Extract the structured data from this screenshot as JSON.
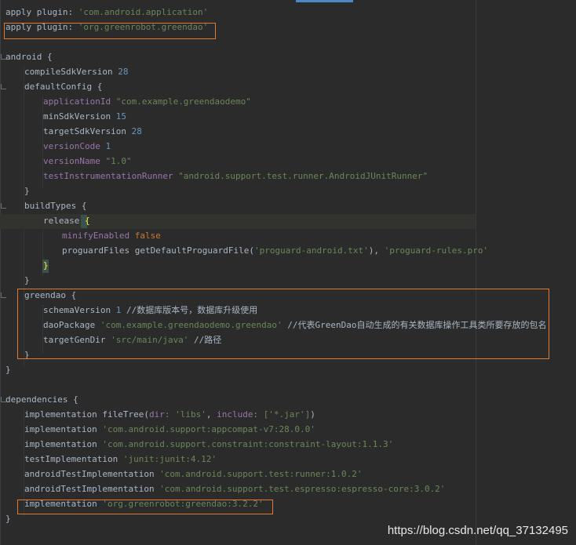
{
  "lines": [
    [
      "apply plugin: ",
      "'com.android.application'"
    ],
    [
      "apply plugin: ",
      "'org.greenrobot.greendao'"
    ],
    [
      "android {"
    ],
    [
      "compileSdkVersion ",
      "28"
    ],
    [
      "defaultConfig {"
    ],
    [
      "applicationId ",
      "\"com.example.greendaodemo\""
    ],
    [
      "minSdkVersion ",
      "15"
    ],
    [
      "targetSdkVersion ",
      "28"
    ],
    [
      "versionCode ",
      "1"
    ],
    [
      "versionName ",
      "\"1.0\""
    ],
    [
      "testInstrumentationRunner ",
      "\"android.support.test.runner.AndroidJUnitRunner\""
    ],
    [
      "}"
    ],
    [
      "buildTypes {"
    ],
    [
      "release ",
      "{"
    ],
    [
      "minifyEnabled ",
      "false"
    ],
    [
      "proguardFiles getDefaultProguardFile(",
      "'proguard-android.txt'",
      "), ",
      "'proguard-rules.pro'"
    ],
    [
      "}"
    ],
    [
      "}"
    ],
    [
      "greendao {"
    ],
    [
      "schemaVersion ",
      "1",
      " //数据库版本号，数据库升级使用"
    ],
    [
      "daoPackage ",
      "'com.example.greendaodemo.greendao'",
      " //代表GreenDao自动生成的有关数据库操作工具类所要存放的包名"
    ],
    [
      "targetGenDir ",
      "'src/main/java'",
      " //路径"
    ],
    [
      "}"
    ],
    [
      "}"
    ],
    [
      "dependencies {"
    ],
    [
      "implementation fileTree(",
      "dir: ",
      "'libs'",
      ", ",
      "include: ",
      "['*.jar']",
      ")"
    ],
    [
      "implementation ",
      "'com.android.support:appcompat-v7:28.0.0'"
    ],
    [
      "implementation ",
      "'com.android.support.constraint:constraint-layout:1.1.3'"
    ],
    [
      "testImplementation ",
      "'junit:junit:4.12'"
    ],
    [
      "androidTestImplementation ",
      "'com.android.support.test:runner:1.0.2'"
    ],
    [
      "androidTestImplementation ",
      "'com.android.support.test.espresso:espresso-core:3.0.2'"
    ],
    [
      "implementation ",
      "'org.greenrobot:greendao:3.2.2'"
    ],
    [
      "}"
    ]
  ],
  "watermark": "https://blog.csdn.net/qq_37132495",
  "colors": {
    "background": "#2b2b2b",
    "keyword": "#cc7832",
    "string": "#6a8759",
    "number": "#6897bb",
    "property": "#9876aa",
    "text": "#a9b7c6",
    "highlight_box": "#e0782e"
  }
}
